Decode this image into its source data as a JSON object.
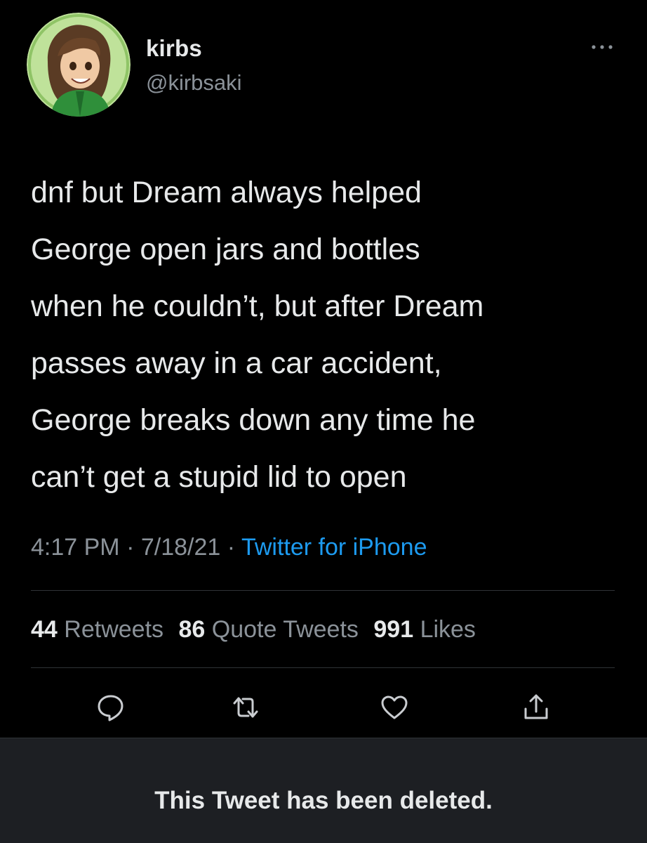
{
  "author": {
    "name": "kirbs",
    "handle": "@kirbsaki",
    "avatar_icon": "profile-avatar"
  },
  "tweet": {
    "text_lines": [
      "dnf but Dream always helped",
      "George open jars and bottles",
      "when he couldn’t, but after Dream",
      "passes away in a car accident,",
      "George breaks down any time he",
      "can’t get a stupid lid to open"
    ],
    "time": "4:17 PM",
    "separator": "·",
    "date": "7/18/21",
    "source": "Twitter for iPhone"
  },
  "stats": {
    "retweets_count": "44",
    "retweets_label": "Retweets",
    "quote_count": "86",
    "quote_label": "Quote Tweets",
    "likes_count": "991",
    "likes_label": "Likes"
  },
  "actions": [
    {
      "name": "reply",
      "icon": "speech-bubble-icon"
    },
    {
      "name": "retweet",
      "icon": "retweet-icon"
    },
    {
      "name": "like",
      "icon": "heart-icon"
    },
    {
      "name": "share",
      "icon": "share-icon"
    }
  ],
  "notice": {
    "text": "This Tweet has been deleted."
  },
  "colors": {
    "background": "#000000",
    "text_primary": "#e7e9ea",
    "text_secondary": "#8b9299",
    "link": "#1d9bf0",
    "notice_background": "#1d1f23",
    "avatar_background": "#bfe29a"
  }
}
